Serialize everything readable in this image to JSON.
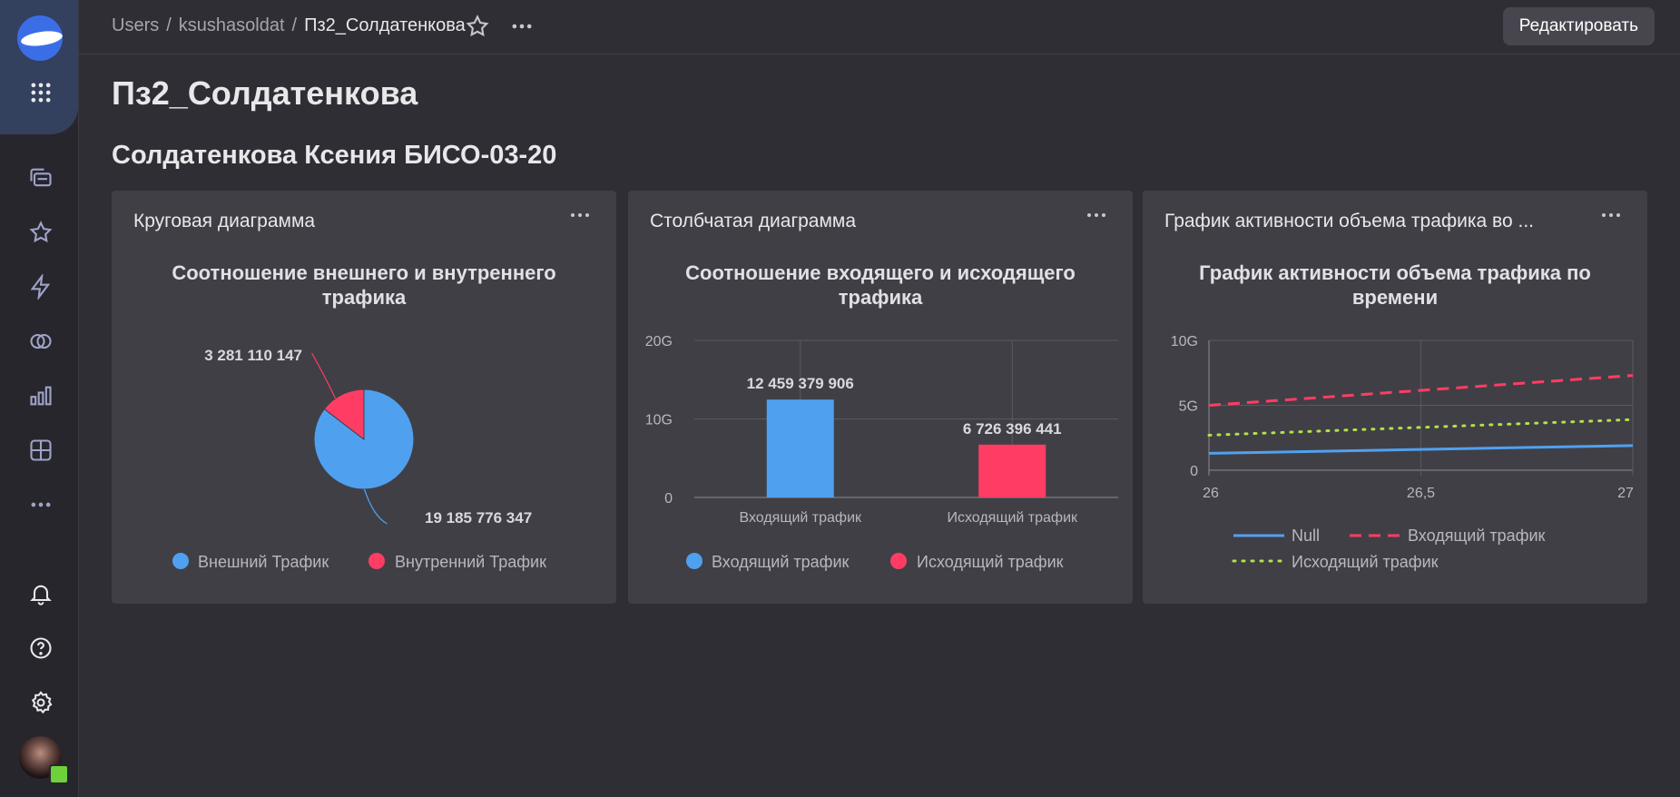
{
  "breadcrumb": {
    "items": [
      "Users",
      "ksushasoldat",
      "Пз2_Солдатенкова"
    ],
    "separator": "/"
  },
  "toolbar": {
    "edit_label": "Редактировать"
  },
  "page": {
    "title": "Пз2_Солдатенкова",
    "subtitle": "Солдатенкова Ксения БИСО-03-20"
  },
  "colors": {
    "blue": "#4fa1f0",
    "red": "#ff3d64",
    "green": "#b3e04a",
    "accent": "#3b6ee6"
  },
  "sidebar": {
    "icons": [
      "logo",
      "apps-grid-icon",
      "folders-icon",
      "star-icon",
      "lightning-icon",
      "connections-icon",
      "chart-icon",
      "dashboard-icon",
      "more-icon",
      "bell-icon",
      "help-icon",
      "settings-icon"
    ]
  },
  "widgets": [
    {
      "title": "Круговая диаграмма"
    },
    {
      "title": "Столбчатая диаграмма"
    },
    {
      "title": "График активности объема трафика во ..."
    }
  ],
  "chart_data": [
    {
      "type": "pie",
      "title": "Соотношение внешнего и внутреннего трафика",
      "series": [
        {
          "name": "Внешний Трафик",
          "value": 19185776347,
          "label": "19 185 776 347",
          "color": "#4fa1f0"
        },
        {
          "name": "Внутренний Трафик",
          "value": 3281110147,
          "label": "3 281 110 147",
          "color": "#ff3d64"
        }
      ],
      "legend": "bottom"
    },
    {
      "type": "bar",
      "title": "Соотношение входящего и исходящего трафика",
      "categories": [
        "Входящий трафик",
        "Исходящий трафик"
      ],
      "values": [
        12459379906,
        6726396441
      ],
      "labels": [
        "12 459 379 906",
        "6 726 396 441"
      ],
      "colors": [
        "#4fa1f0",
        "#ff3d64"
      ],
      "legend_entries": [
        "Входящий трафик",
        "Исходящий трафик"
      ],
      "ylim": [
        0,
        20000000000
      ],
      "yticks": [
        "0",
        "10G",
        "20G"
      ],
      "legend": "bottom",
      "grid": true
    },
    {
      "type": "line",
      "title": "График активности объема трафика по времени",
      "x": [
        26,
        27
      ],
      "xticks": [
        "26",
        "26,5",
        "27"
      ],
      "yticks": [
        "0",
        "5G",
        "10G"
      ],
      "ylim": [
        0,
        10000000000
      ],
      "series": [
        {
          "name": "Null",
          "values": [
            1300000000,
            1900000000
          ],
          "color": "#4fa1f0",
          "dash": "solid"
        },
        {
          "name": "Входящий трафик",
          "values": [
            5000000000,
            7300000000
          ],
          "color": "#ff3d64",
          "dash": "dashed"
        },
        {
          "name": "Исходящий трафик",
          "values": [
            2700000000,
            3900000000
          ],
          "color": "#b3e04a",
          "dash": "dotted"
        }
      ],
      "legend": "bottom",
      "grid": true
    }
  ]
}
